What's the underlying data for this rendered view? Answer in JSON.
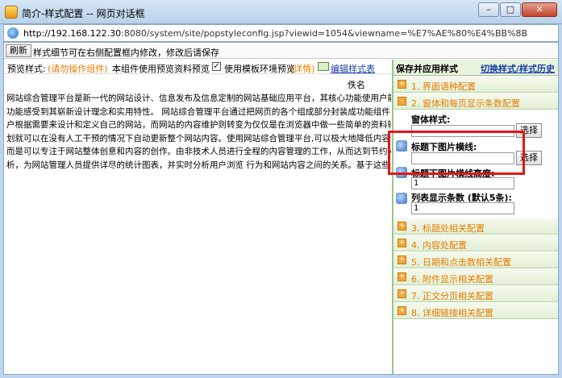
{
  "window": {
    "title": "简介-样式配置 -- 网页对话框",
    "url_host": "http://192.168.122.30",
    "url_rest": ":8080/system/site/popstyleconfig.jsp?viewid=1054&viewname=%E7%AE%80%E4%BB%8B"
  },
  "toolbar": {
    "refresh_label": "刷新",
    "tip": "样式细节可在右侧配置框内修改，修改后请保存"
  },
  "preview": {
    "label": "预览样式:",
    "hint": "(请勿操作组件)",
    "desc": "本组件使用预览资料预览",
    "checkbox_label": "使用模板环境预览",
    "detail_link": "(详情)",
    "edit_style_link": "编辑样式表",
    "author_label": "佚名",
    "article_lines": [
      "网站综合管理平台是新一代的网站设计、信息发布及信息定制的网站基础应用平台，其核心功能使用户能够",
      "功能感受到其崭新设计理念和实用特性。 网站综合管理平台通过把网页的各个组成部分封装成功能组件，",
      "户根据需要来设计和定义自己的网站，而网站的内容维护则转变为仅仅是在浏览器中做一些简单的资料输入",
      "划就可以在没有人工干预的情况下自动更新整个网站内容。使用网站综合管理平台,可以极大地降低内容创作",
      "而是可以专注于网站整体创意和内容的创作。由非技术人员进行全程的内容管理的工作，从而达到节约人力",
      "析，为网站管理人员提供详尽的统计图表，并实时分析用户浏览 行为和网站内容之间的关系。基于这些来"
    ]
  },
  "panel": {
    "apply_label": "保存并应用样式",
    "history_link": "切换样式/样式历史",
    "sections": [
      {
        "num": "1.",
        "label": "界面语种配置"
      },
      {
        "num": "2.",
        "label": "窗体和每页显示条数配置"
      },
      {
        "num": "3.",
        "label": "标题处相关配置"
      },
      {
        "num": "4.",
        "label": "内容处配置"
      },
      {
        "num": "5.",
        "label": "日期和点击数相关配置"
      },
      {
        "num": "6.",
        "label": "附件显示相关配置"
      },
      {
        "num": "7.",
        "label": "正文分页相关配置"
      },
      {
        "num": "8.",
        "label": "详细链接相关配置"
      }
    ],
    "fields": {
      "window_style_label": "窗体样式:",
      "window_style_value": "",
      "title_img_label": "标题下图片横线:",
      "title_img_value": "",
      "title_img_height_label": "标题下图片横线高度:",
      "title_img_height_value": "1",
      "list_count_label": "列表显示条数 (默认5条):",
      "list_count_value": "1",
      "pick_label": "选择"
    }
  }
}
